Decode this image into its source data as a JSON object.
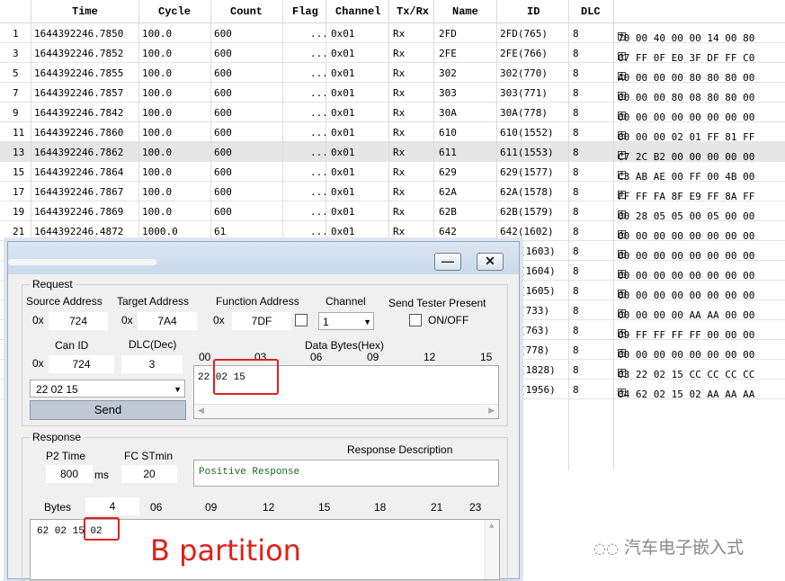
{
  "grid": {
    "headers": {
      "time": "Time",
      "cycle": "Cycle",
      "count": "Count",
      "flag": "Flag",
      "channel": "Channel",
      "txrx": "Tx/Rx",
      "name": "Name",
      "id": "ID",
      "dlc": "DLC"
    },
    "rows": [
      {
        "no": "1",
        "time": "1644392246.7850",
        "cycle": "100.0",
        "count": "600",
        "flag": "...",
        "channel": "0x01",
        "txrx": "Rx",
        "name": "2FD",
        "id": "2FD(765)",
        "dlc": "8",
        "data": "70 00 40 00 00 14 00 80"
      },
      {
        "no": "3",
        "time": "1644392246.7852",
        "cycle": "100.0",
        "count": "600",
        "flag": "...",
        "channel": "0x01",
        "txrx": "Rx",
        "name": "2FE",
        "id": "2FE(766)",
        "dlc": "8",
        "data": "07 FF 0F E0 3F DF FF C0"
      },
      {
        "no": "5",
        "time": "1644392246.7855",
        "cycle": "100.0",
        "count": "600",
        "flag": "...",
        "channel": "0x01",
        "txrx": "Rx",
        "name": "302",
        "id": "302(770)",
        "dlc": "8",
        "data": "A0 00 00 00 80 80 80 00"
      },
      {
        "no": "7",
        "time": "1644392246.7857",
        "cycle": "100.0",
        "count": "600",
        "flag": "...",
        "channel": "0x01",
        "txrx": "Rx",
        "name": "303",
        "id": "303(771)",
        "dlc": "8",
        "data": "00 00 00 80 08 80 80 00"
      },
      {
        "no": "9",
        "time": "1644392246.7842",
        "cycle": "100.0",
        "count": "600",
        "flag": "...",
        "channel": "0x01",
        "txrx": "Rx",
        "name": "30A",
        "id": "30A(778)",
        "dlc": "8",
        "data": "00 00 00 00 00 00 00 00"
      },
      {
        "no": "11",
        "time": "1644392246.7860",
        "cycle": "100.0",
        "count": "600",
        "flag": "...",
        "channel": "0x01",
        "txrx": "Rx",
        "name": "610",
        "id": "610(1552)",
        "dlc": "8",
        "data": "00 00 00 02 01 FF 81 FF"
      },
      {
        "no": "13",
        "time": "1644392246.7862",
        "cycle": "100.0",
        "count": "600",
        "flag": "...",
        "channel": "0x01",
        "txrx": "Rx",
        "name": "611",
        "id": "611(1553)",
        "dlc": "8",
        "data": "C7 2C B2 00 00 00 00 00"
      },
      {
        "no": "15",
        "time": "1644392246.7864",
        "cycle": "100.0",
        "count": "600",
        "flag": "...",
        "channel": "0x01",
        "txrx": "Rx",
        "name": "629",
        "id": "629(1577)",
        "dlc": "8",
        "data": "C3 AB AE 00 FF 00 4B 00"
      },
      {
        "no": "17",
        "time": "1644392246.7867",
        "cycle": "100.0",
        "count": "600",
        "flag": "...",
        "channel": "0x01",
        "txrx": "Rx",
        "name": "62A",
        "id": "62A(1578)",
        "dlc": "8",
        "data": "FF FF FA 8F E9 FF 8A FF"
      },
      {
        "no": "19",
        "time": "1644392246.7869",
        "cycle": "100.0",
        "count": "600",
        "flag": "...",
        "channel": "0x01",
        "txrx": "Rx",
        "name": "62B",
        "id": "62B(1579)",
        "dlc": "8",
        "data": "00 28 05 05 00 05 00 00"
      },
      {
        "no": "21",
        "time": "1644392246.4872",
        "cycle": "1000.0",
        "count": "61",
        "flag": "...",
        "channel": "0x01",
        "txrx": "Rx",
        "name": "642",
        "id": "642(1602)",
        "dlc": "8",
        "data": "00 00 00 00 00 00 00 00"
      }
    ],
    "partial_rows": [
      {
        "id": "(1603)",
        "data": "00 00 00 00 00 00 00 00"
      },
      {
        "id": "(1604)",
        "data": "00 00 00 00 00 00 00 00"
      },
      {
        "id": "(1605)",
        "data": "00 00 00 00 00 00 00 00"
      },
      {
        "id": "(733)",
        "data": "00 00 00 00 AA AA 00 00"
      },
      {
        "id": "(763)",
        "data": "09 FF FF FF FF 00 00 00"
      },
      {
        "id": "(778)",
        "data": "00 00 00 00 00 00 00 00"
      },
      {
        "id": "(1828)",
        "data": "03 22 02 15 CC CC CC CC"
      },
      {
        "id": "(1956)",
        "data": "04 62 02 15 02 AA AA AA"
      }
    ]
  },
  "dialog": {
    "minimize_glyph": "—",
    "close_glyph": "✕",
    "request": {
      "title": "Request",
      "source_address_label": "Source Address",
      "target_address_label": "Target Address",
      "function_address_label": "Function Address",
      "channel_label": "Channel",
      "send_tester_present_label": "Send Tester Present",
      "hex_prefix": "0x",
      "source_address": "724",
      "target_address": "7A4",
      "function_address": "7DF",
      "channel": "1",
      "onoff_label": "ON/OFF",
      "can_id_label": "Can ID",
      "dlc_label": "DLC(Dec)",
      "data_bytes_label": "Data Bytes(Hex)",
      "can_id": "724",
      "dlc": "3",
      "byte_ticks": [
        "00",
        "03",
        "06",
        "09",
        "12",
        "15"
      ],
      "data_bytes": "22 02 15",
      "history_value": "22 02 15",
      "send_label": "Send"
    },
    "response": {
      "title": "Response",
      "p2_time_label": "P2 Time",
      "fc_stmin_label": "FC STmin",
      "description_label": "Response Description",
      "p2_time": "800",
      "ms_label": "ms",
      "fc_stmin": "20",
      "description": "Positive Response",
      "bytes_label": "Bytes",
      "bytes_count": "4",
      "byte_ticks": [
        "06",
        "09",
        "12",
        "15",
        "18",
        "21",
        "23"
      ],
      "data_prefix": "62 02 15",
      "data_highlight": "02"
    }
  },
  "annotation": {
    "text": "B partition"
  },
  "watermark": {
    "text": "汽车电子嵌入式"
  }
}
